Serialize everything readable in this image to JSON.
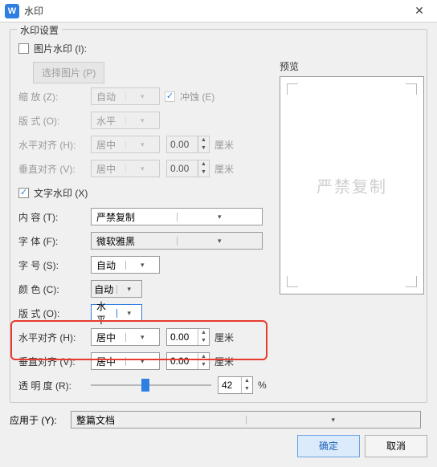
{
  "window": {
    "title": "水印"
  },
  "group": {
    "title": "水印设置"
  },
  "pic": {
    "checkbox": "图片水印 (I):",
    "select": "选择图片 (P)",
    "scale": "缩   放 (Z):",
    "scale_val": "自动",
    "washout": "冲蚀 (E)",
    "layout": "版   式 (O):",
    "layout_val": "水平",
    "halign": "水平对齐 (H):",
    "halign_val": "居中",
    "halign_num": "0.00",
    "valign": "垂直对齐 (V):",
    "valign_val": "居中",
    "valign_num": "0.00",
    "unit": "厘米"
  },
  "txt": {
    "checkbox": "文字水印 (X)",
    "content": "内   容 (T):",
    "content_val": "严禁复制",
    "font": "字   体 (F):",
    "font_val": "微软雅黑",
    "size": "字   号 (S):",
    "size_val": "自动",
    "color": "颜   色 (C):",
    "color_val": "自动",
    "layout": "版   式 (O):",
    "layout_val": "水平",
    "halign": "水平对齐 (H):",
    "halign_val": "居中",
    "halign_num": "0.00",
    "valign": "垂直对齐 (V):",
    "valign_val": "居中",
    "valign_num": "0.00",
    "unit": "厘米",
    "opacity": "透 明 度 (R):",
    "opacity_val": "42",
    "opacity_unit": "%"
  },
  "preview": {
    "label": "预览",
    "watermark": "严禁复制"
  },
  "apply": {
    "label": "应用于 (Y):",
    "value": "整篇文档"
  },
  "buttons": {
    "ok": "确定",
    "cancel": "取消"
  }
}
